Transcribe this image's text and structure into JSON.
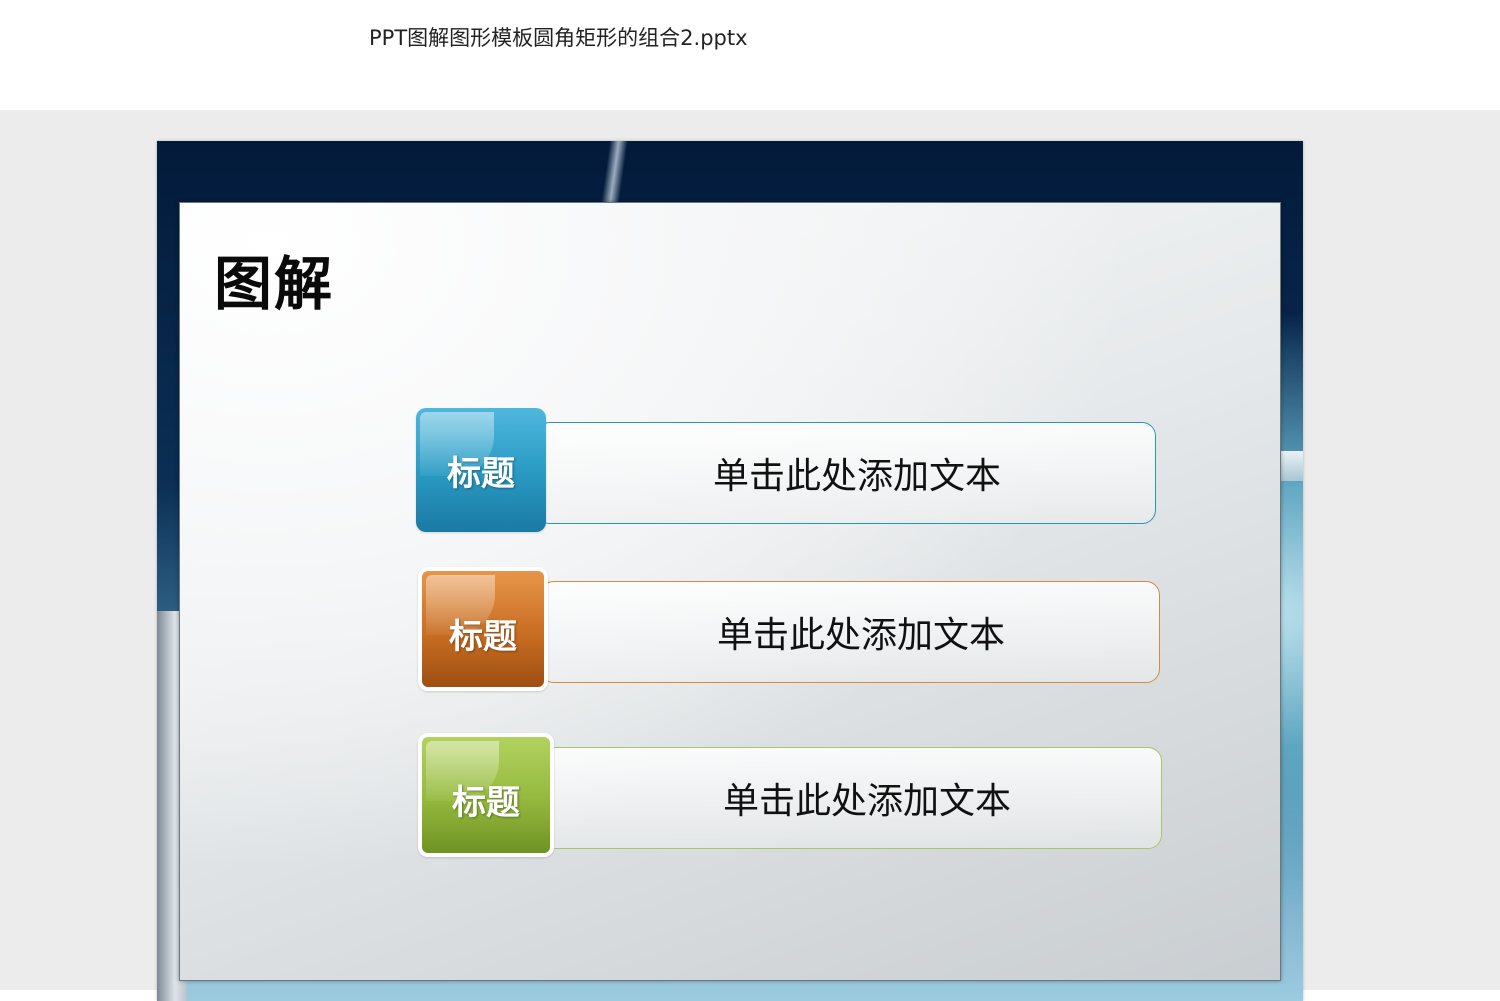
{
  "window": {
    "file_title": "PPT图解图形模板圆角矩形的组合2.pptx"
  },
  "slide": {
    "title": "图解",
    "rows": [
      {
        "badge_label": "标题",
        "text": "单击此处添加文本",
        "color": "#2a9cc4"
      },
      {
        "badge_label": "标题",
        "text": "单击此处添加文本",
        "color": "#c86d22"
      },
      {
        "badge_label": "标题",
        "text": "单击此处添加文本",
        "color": "#94b83d"
      }
    ]
  }
}
